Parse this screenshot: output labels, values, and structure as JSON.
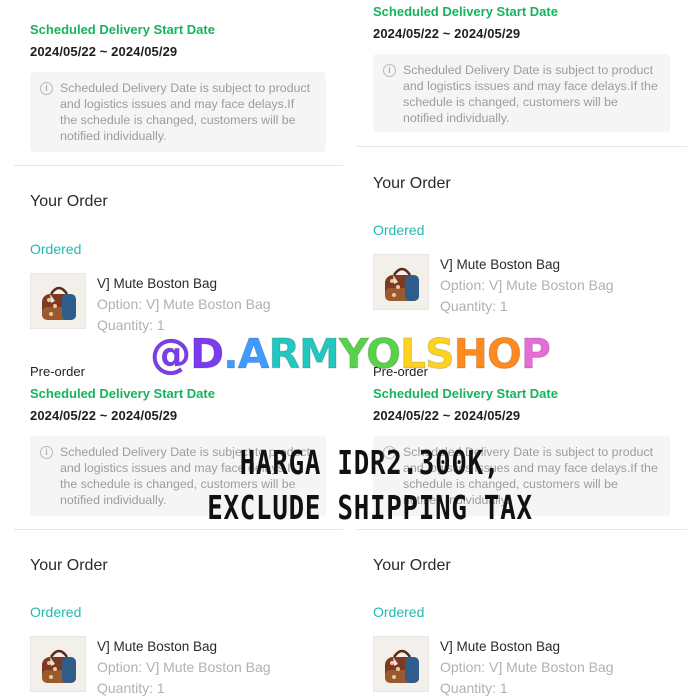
{
  "left": {
    "top_title": "Scheduled Delivery Start Date",
    "top_dates": "2024/05/22 ~ 2024/05/29",
    "notice_top": "Scheduled Delivery Date is subject to product and logistics issues and may face delays.If the schedule is changed, customers will be notified individually.",
    "your_order": "Your Order",
    "ordered": "Ordered",
    "product_name": "V] Mute Boston Bag",
    "product_option": "Option: V] Mute Boston Bag",
    "product_qty": "Quantity: 1",
    "preorder": "Pre-order",
    "mid_title": "Scheduled Delivery Start Date",
    "mid_dates": "2024/05/22 ~ 2024/05/29",
    "notice_mid": "Scheduled Delivery Date is subject to product and logistics issues and may face delays.If the schedule is changed, customers will be notified individually.",
    "your_order_2": "Your Order",
    "ordered_2": "Ordered",
    "product_name_2": "V] Mute Boston Bag",
    "product_option_2": "Option: V] Mute Boston Bag",
    "product_qty_2": "Quantity: 1"
  },
  "right": {
    "top_title": "Scheduled Delivery Start Date",
    "top_dates": "2024/05/22 ~ 2024/05/29",
    "notice_top": "Scheduled Delivery Date is subject to product and logistics issues and may face delays.If the schedule is changed, customers will be notified individually.",
    "your_order": "Your Order",
    "ordered": "Ordered",
    "product_name": "V] Mute Boston Bag",
    "product_option": "Option: V] Mute Boston Bag",
    "product_qty": "Quantity: 1",
    "preorder": "Pre-order",
    "mid_title": "Scheduled Delivery Start Date",
    "mid_dates": "2024/05/22 ~ 2024/05/29",
    "notice_mid": "Scheduled Delivery Date is subject to product and logistics issues and may face delays.If the schedule is changed, customers will be notified individually.",
    "your_order_2": "Your Order",
    "ordered_2": "Ordered",
    "product_name_2": "V] Mute Boston Bag",
    "product_option_2": "Option: V] Mute Boston Bag",
    "product_qty_2": "Quantity: 1"
  },
  "overlay": {
    "watermark": "@D.ARMYOLSHOP",
    "price_line1": "HARGA IDR2.300K,",
    "price_line2": "EXCLUDE SHIPPING TAX"
  },
  "icons": {
    "info": "info-icon",
    "product": "boston-bag-thumbnail"
  },
  "colors": {
    "delivery_green": "#16b35e",
    "ordered_teal": "#23b8b0",
    "muted_text": "#9c9ca2",
    "notice_bg": "#f5f5f6",
    "watermark_gradient": [
      "#7b3cf0",
      "#3f9bff",
      "#22c7c0",
      "#59d14b",
      "#ffd21f",
      "#ff8a1f",
      "#e86cd8"
    ]
  }
}
